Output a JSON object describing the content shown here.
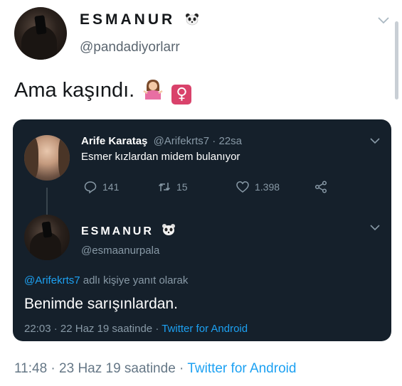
{
  "outer_tweet": {
    "display_name": "ESMANUR",
    "handle": "@pandadiyorlarr",
    "text": "Ama kaşındı.",
    "time": "11:48",
    "date_sep": " · ",
    "date": "23 Haz 19 saatinde",
    "src_sep": " · ",
    "source": "Twitter for Android"
  },
  "quoted_tweet": {
    "name": "Arife Karataş",
    "handle": "@Arifekrts7",
    "sep": " · ",
    "age": "22sa",
    "text": "Esmer kızlardan midem bulanıyor",
    "replies": "141",
    "retweets": "15",
    "likes": "1.398"
  },
  "reply_tweet": {
    "display_name": "ESMANUR",
    "handle": "@esmaanurpala",
    "mention": "@Arifekrts7",
    "replying_suffix": " adlı kişiye yanıt olarak",
    "text": "Benimde sarışınlardan.",
    "time": "22:03",
    "date_sep": " · ",
    "date": "22 Haz 19 saatinde",
    "src_sep": " · ",
    "source": "Twitter for Android"
  },
  "colors": {
    "dark_bg": "#15202b",
    "accent": "#1da1f2",
    "muted": "#8899a6",
    "female_sign": "#d9426b"
  }
}
